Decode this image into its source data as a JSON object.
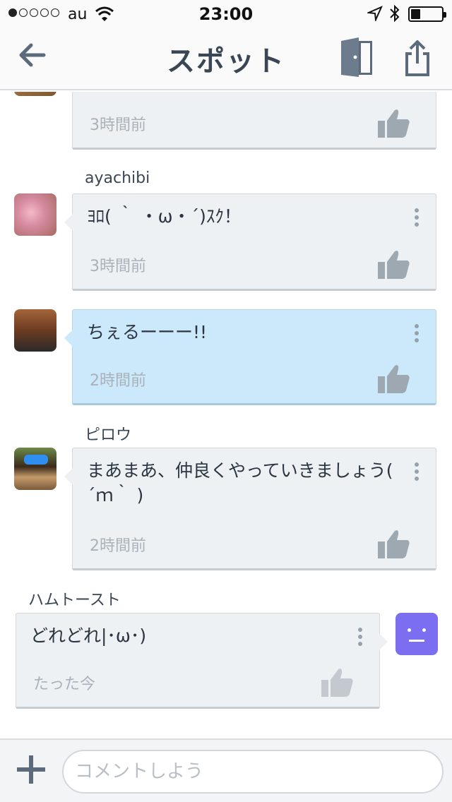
{
  "status_bar": {
    "carrier": "au",
    "time": "23:00",
    "battery_level": 0.3,
    "signal_bars_filled": 1,
    "signal_bars_total": 5
  },
  "nav": {
    "title": "スポット",
    "back_icon": "arrow-left-icon",
    "door_icon": "door-exit-icon",
    "share_icon": "share-icon"
  },
  "messages": [
    {
      "user": "",
      "text": "",
      "time": "3時間前",
      "style": "default"
    },
    {
      "user": "ayachibi",
      "text": "ﾖﾛ( ｀ ・ω・´)ｽｸ！",
      "time": "3時間前",
      "style": "default"
    },
    {
      "user": "",
      "text": "ちぇるーーー!!",
      "time": "2時間前",
      "style": "highlight"
    },
    {
      "user": "ピロウ",
      "text": "まあまあ、仲良くやっていきましょう( ´ｍ｀ )",
      "time": "2時間前",
      "style": "default"
    },
    {
      "user": "ハムトースト",
      "text": "どれどれ|･ω･)",
      "time": "たった今",
      "style": "own"
    }
  ],
  "input": {
    "placeholder": "コメントしよう"
  },
  "colors": {
    "accent_gray": "#5b6b7b",
    "bubble": "#eef1f4",
    "highlight_bubble": "#cbe9fb",
    "own_avatar": "#7b6ef0"
  }
}
